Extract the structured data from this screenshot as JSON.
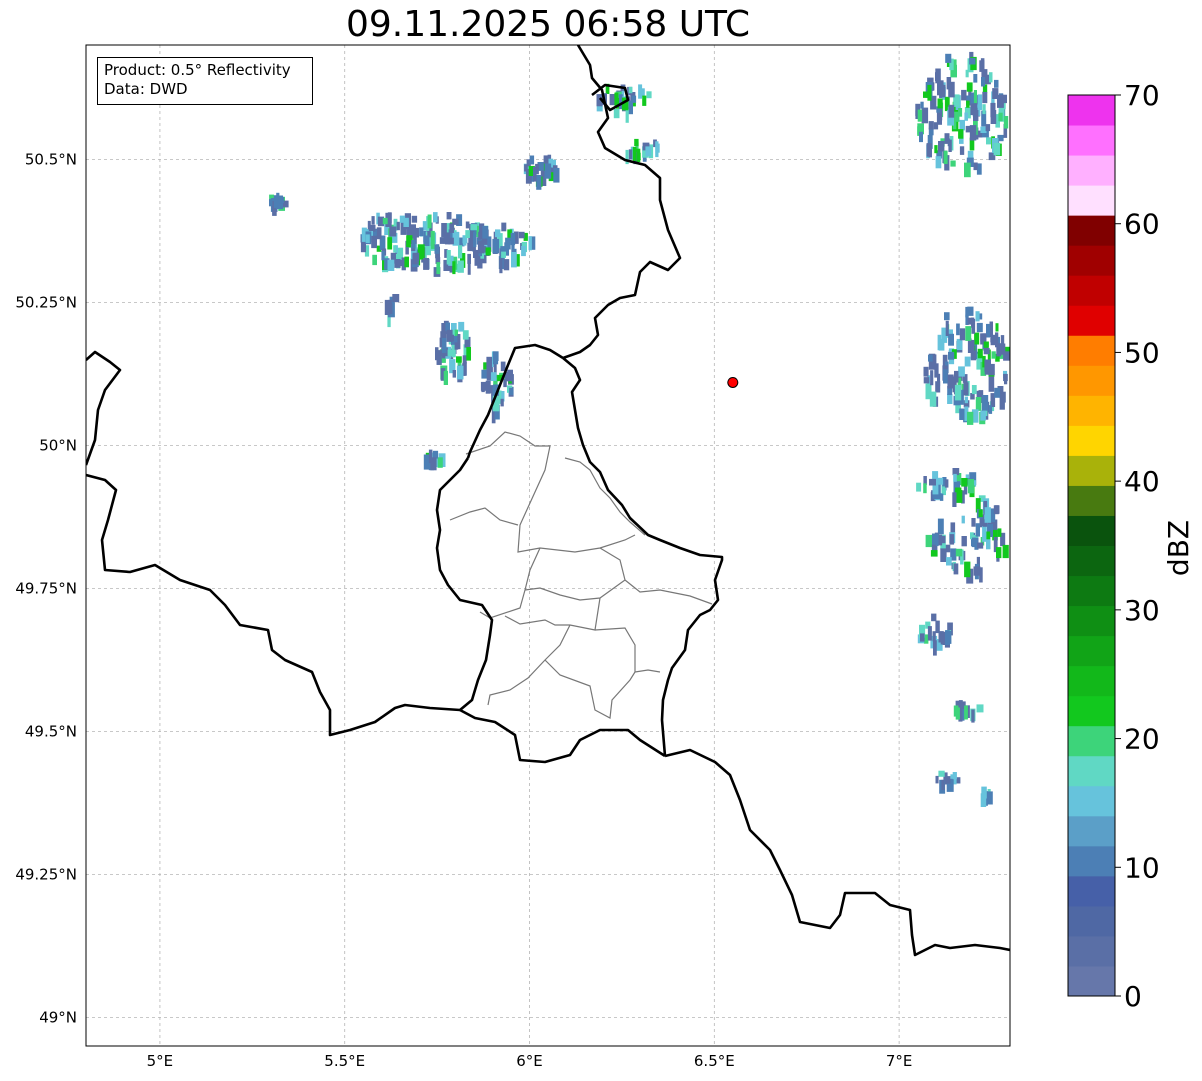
{
  "title": "09.11.2025 06:58 UTC",
  "info_box": {
    "product": "Product: 0.5° Reflectivity",
    "data": "Data: DWD"
  },
  "map": {
    "lon_range": [
      4.8,
      7.3
    ],
    "lat_range": [
      48.95,
      50.7
    ],
    "lon_ticks": [
      {
        "value": 5.0,
        "label": "5°E"
      },
      {
        "value": 5.5,
        "label": "5.5°E"
      },
      {
        "value": 6.0,
        "label": "6°E"
      },
      {
        "value": 6.5,
        "label": "6.5°E"
      },
      {
        "value": 7.0,
        "label": "7°E"
      }
    ],
    "lat_ticks": [
      {
        "value": 49.0,
        "label": "49°N"
      },
      {
        "value": 49.25,
        "label": "49.25°N"
      },
      {
        "value": 49.5,
        "label": "49.5°N"
      },
      {
        "value": 49.75,
        "label": "49.75°N"
      },
      {
        "value": 50.0,
        "label": "50°N"
      },
      {
        "value": 50.25,
        "label": "50.25°N"
      },
      {
        "value": 50.5,
        "label": "50.5°N"
      }
    ],
    "grid": true,
    "radar_site": {
      "lon": 6.55,
      "lat": 50.11,
      "color": "#ff0000"
    }
  },
  "colorbar": {
    "label": "dBZ",
    "min": 0,
    "max": 70,
    "ticks": [
      {
        "value": 0,
        "label": "0"
      },
      {
        "value": 10,
        "label": "10"
      },
      {
        "value": 20,
        "label": "20"
      },
      {
        "value": 30,
        "label": "30"
      },
      {
        "value": 40,
        "label": "40"
      },
      {
        "value": 50,
        "label": "50"
      },
      {
        "value": 60,
        "label": "60"
      },
      {
        "value": 70,
        "label": "70"
      }
    ],
    "colors": [
      "#6677aa",
      "#5a6fa6",
      "#4f68a4",
      "#4660a8",
      "#4c7fb5",
      "#5b9fc8",
      "#66c3dc",
      "#60d8c4",
      "#3dd47a",
      "#12c81e",
      "#12b81a",
      "#11a417",
      "#0f8f14",
      "#0d7a12",
      "#0c6610",
      "#0a530d",
      "#487a10",
      "#a9b20a",
      "#ffd500",
      "#ffb400",
      "#ff9700",
      "#ff7d00",
      "#e00000",
      "#c00000",
      "#a00000",
      "#800000",
      "#ffe0ff",
      "#ffb0ff",
      "#ff70ff",
      "#ee33ee"
    ]
  },
  "echo_colors": [
    "#5a6fa6",
    "#4c7fb5",
    "#66c3dc",
    "#60d8c4",
    "#3dd47a",
    "#12c81e"
  ]
}
